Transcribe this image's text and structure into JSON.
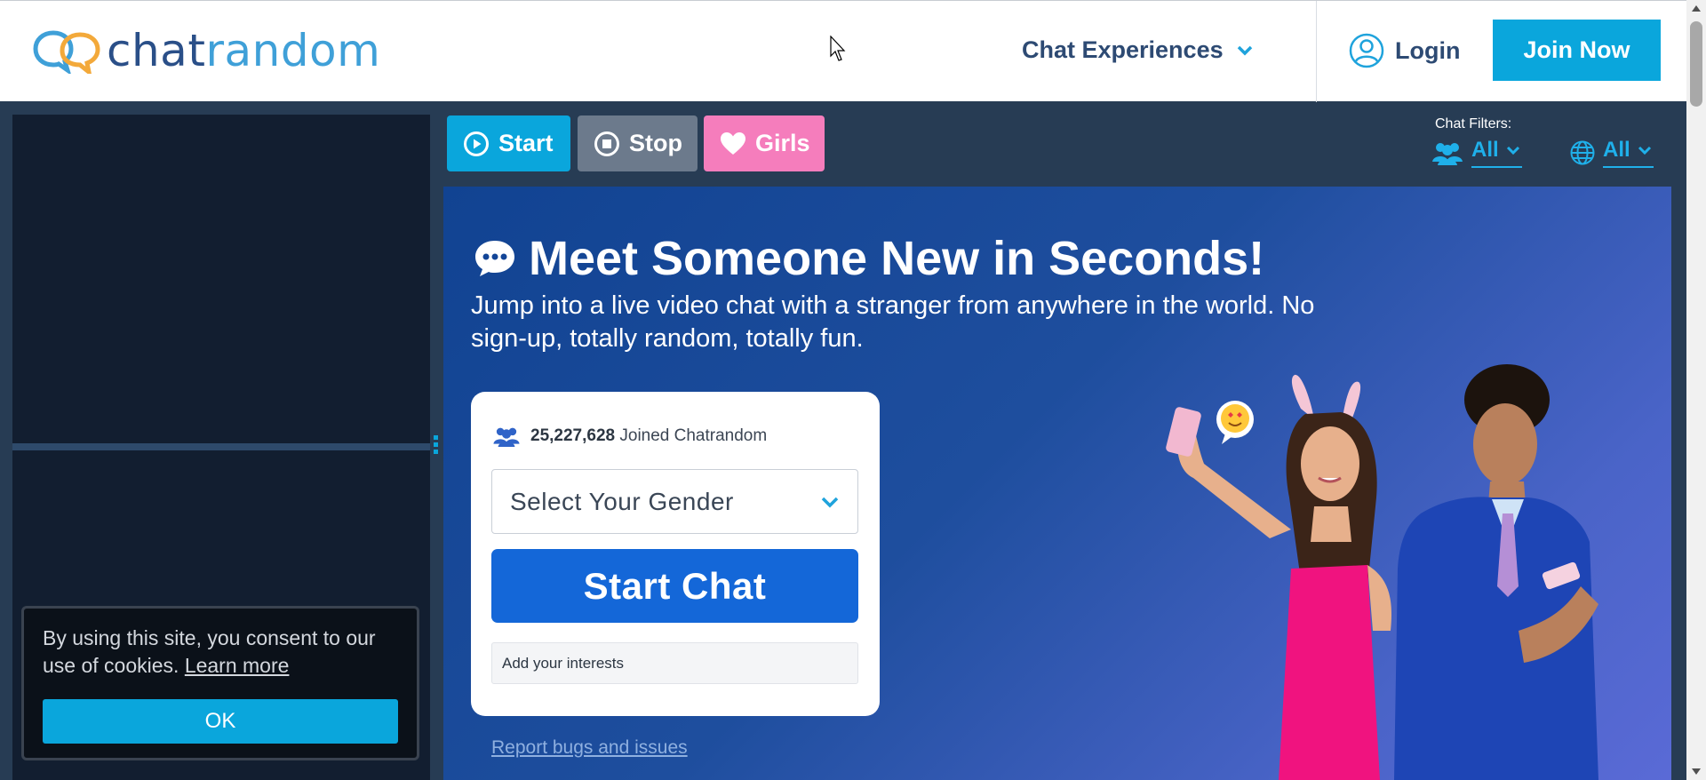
{
  "brand": {
    "chat": "chat",
    "random": "random"
  },
  "nav": {
    "chat_experiences": "Chat Experiences",
    "login": "Login",
    "join_now": "Join Now"
  },
  "toolbar": {
    "start": "Start",
    "stop": "Stop",
    "girls": "Girls"
  },
  "filters": {
    "label": "Chat Filters:",
    "people_value": "All",
    "region_value": "All"
  },
  "hero": {
    "title": "Meet Someone New in Seconds!",
    "subtitle": "Jump into a live video chat with a stranger from anywhere in the world. No sign-up, totally random, totally fun."
  },
  "card": {
    "joined_count": "25,227,628",
    "joined_text": "Joined Chatrandom",
    "gender_placeholder": "Select Your Gender",
    "start_chat": "Start Chat",
    "interests_placeholder": "Add your interests"
  },
  "report_link": "Report bugs and issues",
  "cookie": {
    "text": "By using this site, you consent to our use of cookies.",
    "learn_more": "Learn more",
    "ok": "OK"
  },
  "colors": {
    "accent": "#0aa6dc",
    "brand_dark": "#2a4f88",
    "pink": "#f57dbc",
    "start_chat": "#1467d8"
  }
}
